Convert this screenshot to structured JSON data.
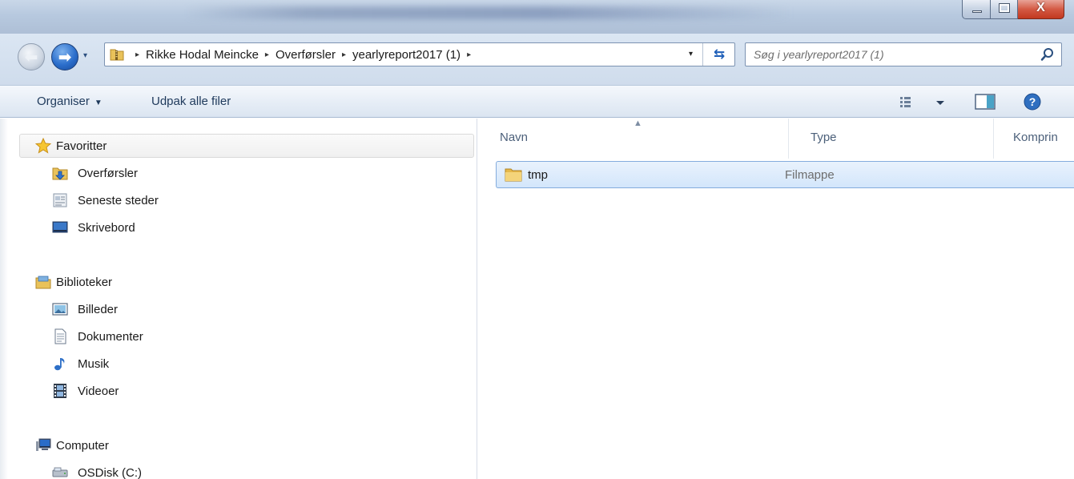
{
  "window": {
    "controls": {
      "minimize": "minimize",
      "maximize": "maximize",
      "close": "X"
    }
  },
  "address": {
    "crumbs": [
      "Rikke Hodal Meincke",
      "Overførsler",
      "yearlyreport2017 (1)"
    ],
    "separator": "▸",
    "dropdown": "▾",
    "refresh": "⇆"
  },
  "search": {
    "placeholder": "Søg i yearlyreport2017 (1)"
  },
  "toolbar": {
    "organise_label": "Organiser",
    "organise_caret": "▼",
    "extract_label": "Udpak alle filer"
  },
  "navpane": {
    "favorites": {
      "label": "Favoritter",
      "items": [
        {
          "label": "Overførsler",
          "icon": "downloads-folder-icon"
        },
        {
          "label": "Seneste steder",
          "icon": "recent-places-icon"
        },
        {
          "label": "Skrivebord",
          "icon": "desktop-icon"
        }
      ]
    },
    "libraries": {
      "label": "Biblioteker",
      "items": [
        {
          "label": "Billeder",
          "icon": "pictures-icon"
        },
        {
          "label": "Dokumenter",
          "icon": "documents-icon"
        },
        {
          "label": "Musik",
          "icon": "music-icon"
        },
        {
          "label": "Videoer",
          "icon": "videos-icon"
        }
      ]
    },
    "computer": {
      "label": "Computer",
      "items": [
        {
          "label": "OSDisk (C:)",
          "icon": "drive-icon"
        }
      ]
    }
  },
  "content": {
    "columns": [
      "Navn",
      "Type",
      "Komprimeret størrelse"
    ],
    "columns_visible": [
      "Navn",
      "Type",
      "Komprin"
    ],
    "rows": [
      {
        "name": "tmp",
        "type": "Filmappe",
        "selected": true
      }
    ]
  },
  "colors": {
    "selection": "#d3e6fb",
    "selection_border": "#84acdd",
    "toolbar_text": "#1e395b",
    "header_text": "#4c607a"
  }
}
